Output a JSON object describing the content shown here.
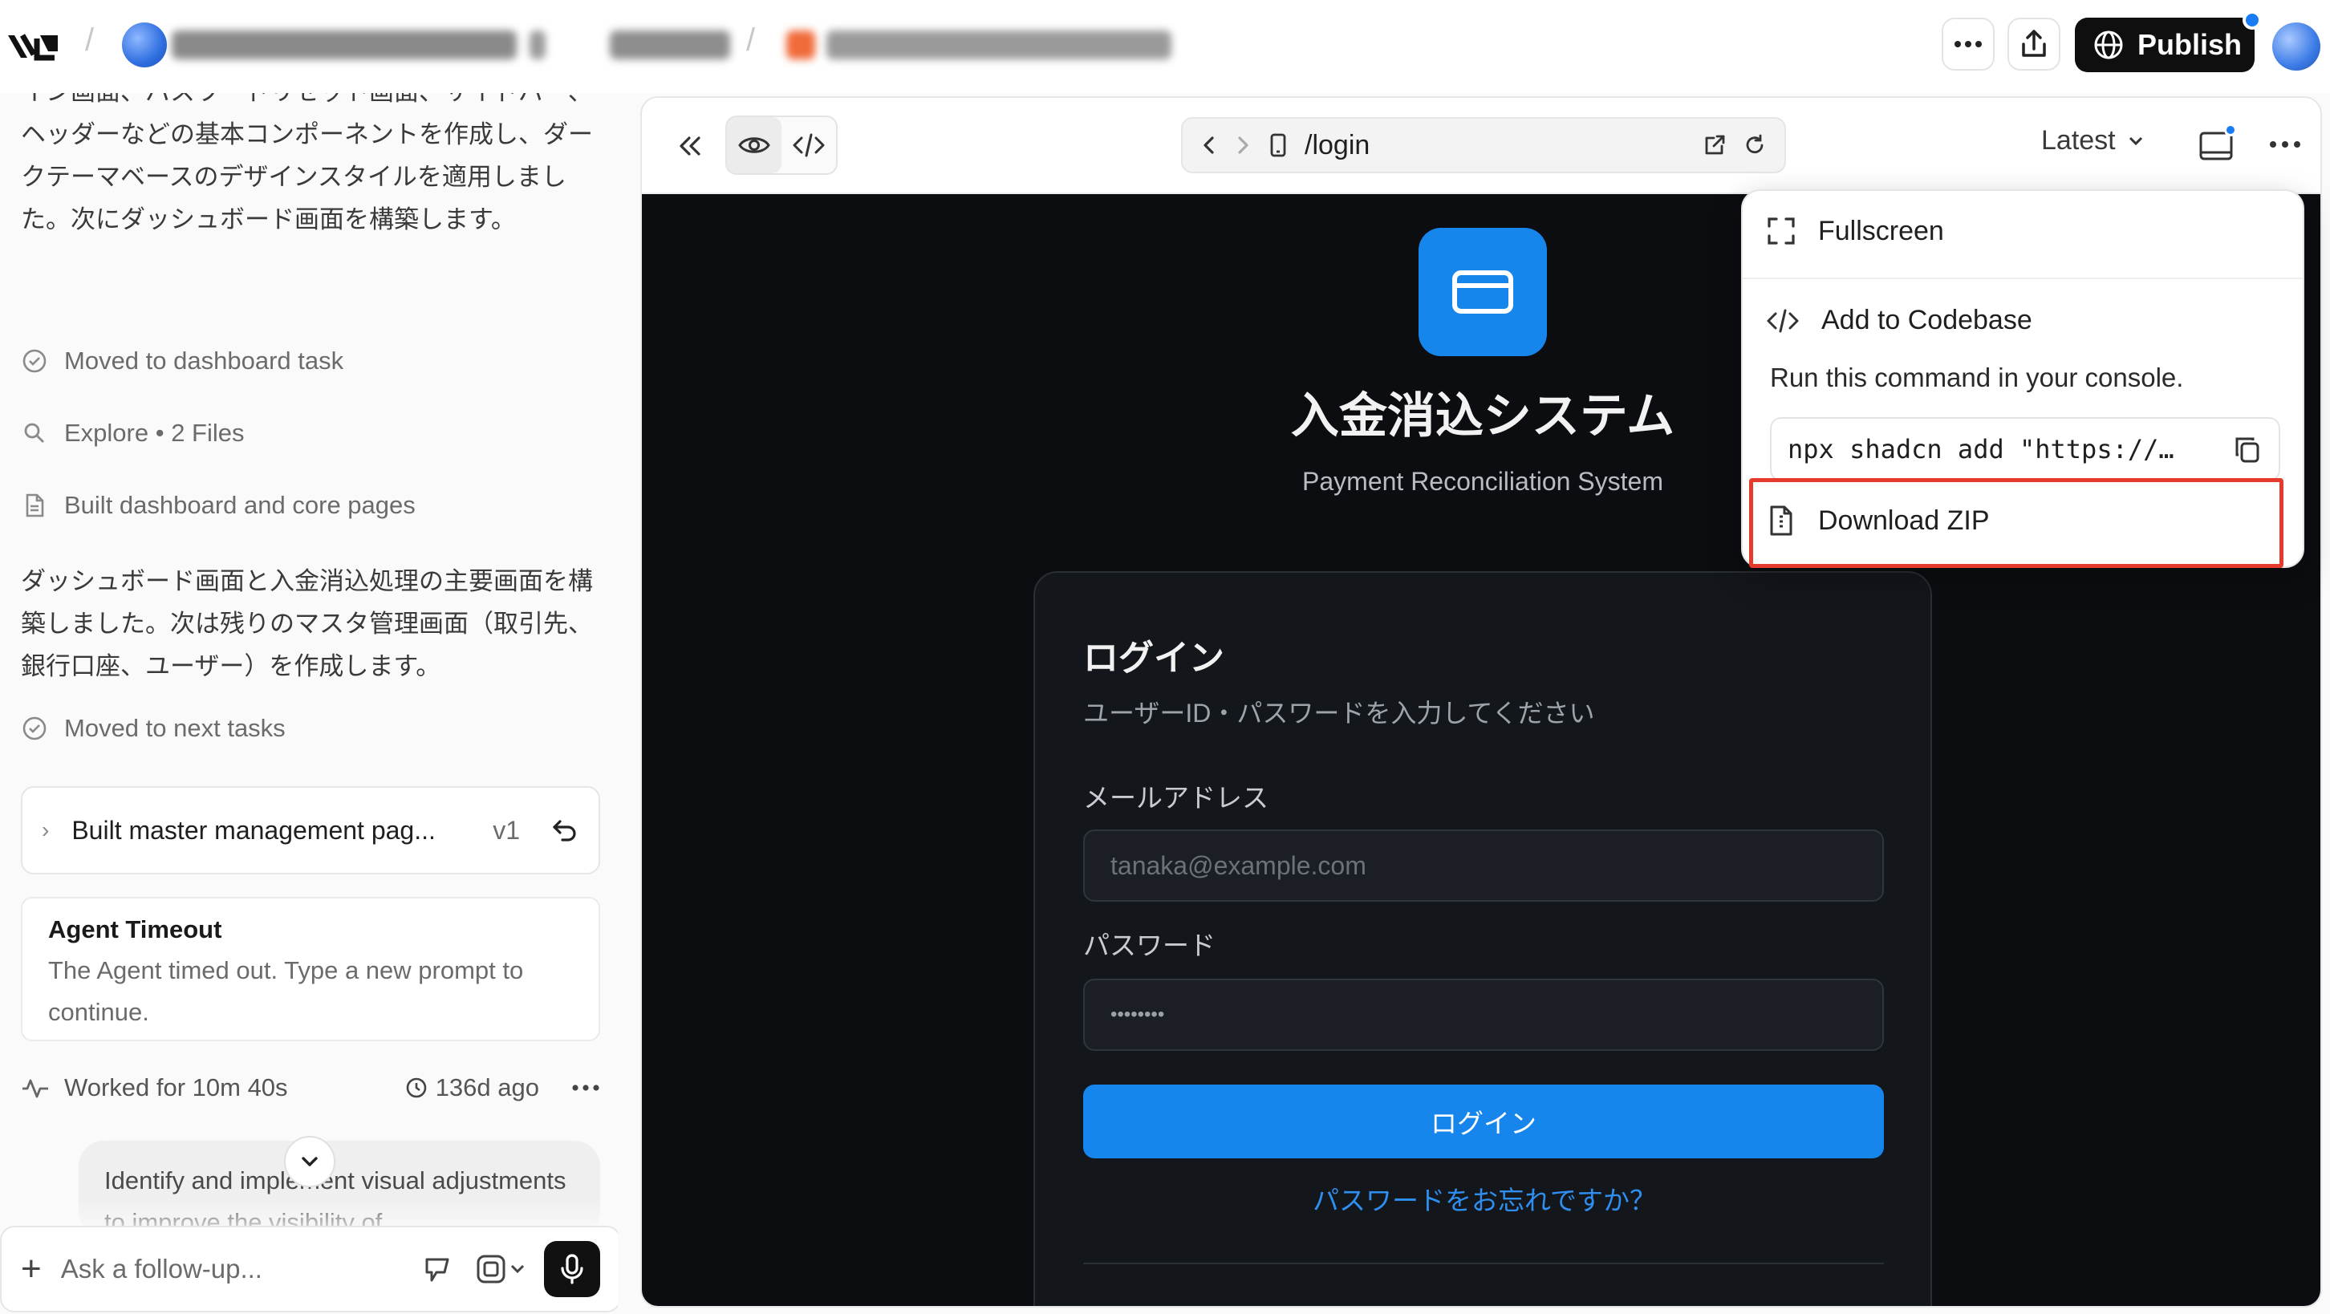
{
  "topbar": {
    "publish_label": "Publish"
  },
  "chat": {
    "message1": "イン画面、パスワードリセット画面、サイドバー、ヘッダーなどの基本コンポーネントを作成し、ダークテーマベースのデザインスタイルを適用しました。次にダッシュボード画面を構築します。",
    "step1": "Moved to dashboard task",
    "step2": "Explore • 2 Files",
    "step3": "Built dashboard and core pages",
    "message2": "ダッシュボード画面と入金消込処理の主要画面を構築しました。次は残りのマスタ管理画面（取引先、銀行口座、ユーザー）を作成します。",
    "step4": "Moved to next tasks",
    "version_title": "Built master management pag...",
    "version_tag": "v1",
    "timeout_title": "Agent Timeout",
    "timeout_body": "The Agent timed out. Type a new prompt to continue.",
    "worked_label": "Worked for 10m 40s",
    "worked_ago": "136d ago",
    "suggestion": "Identify and implement visual adjustments to improve the visibility of",
    "composer_placeholder": "Ask a follow-up..."
  },
  "preview": {
    "url": "/login",
    "version_select": "Latest"
  },
  "app": {
    "title": "入金消込システム",
    "subtitle": "Payment Reconciliation System",
    "card_title": "ログイン",
    "card_desc": "ユーザーID・パスワードを入力してください",
    "email_label": "メールアドレス",
    "email_placeholder": "tanaka@example.com",
    "password_label": "パスワード",
    "password_value": "••••••••",
    "login_button": "ログイン",
    "forgot_link": "パスワードをお忘れですか？"
  },
  "menu": {
    "fullscreen": "Fullscreen",
    "add_to_codebase": "Add to Codebase",
    "command_hint": "Run this command in your console.",
    "command": "npx shadcn add \"https://…",
    "download_zip": "Download ZIP"
  },
  "colors": {
    "accent": "#1686ec",
    "highlight_border": "#e53a2c",
    "publish_bg": "#0f0f0f"
  }
}
